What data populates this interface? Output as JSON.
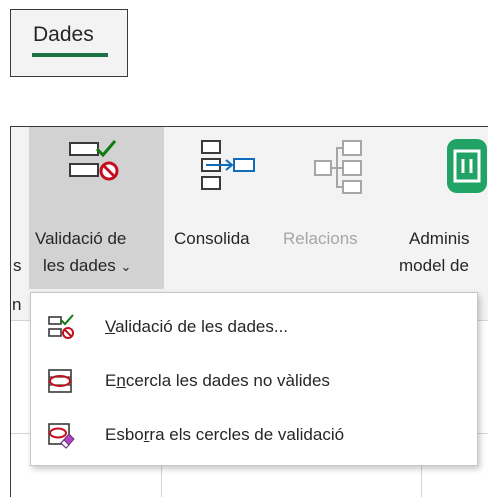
{
  "tab": {
    "label": "Dades"
  },
  "ribbon": {
    "validacio": {
      "line1": "Validació de",
      "line2": "les dades",
      "caret": "⌄"
    },
    "consolida": {
      "label": "Consolida"
    },
    "relacions": {
      "label": "Relacions"
    },
    "admin": {
      "line1": "Adminis",
      "line2": "model de"
    },
    "fragments": {
      "left_line2": "s",
      "group_label": "n"
    }
  },
  "menu": {
    "items": [
      {
        "label": "Validació de les dades...",
        "icon": "data-validation-icon",
        "mnemonic": "V"
      },
      {
        "label": "Encercla les dades no vàlides",
        "icon": "circle-invalid-data-icon",
        "mnemonic": "n"
      },
      {
        "label": "Esborra els cercles de validació",
        "icon": "clear-validation-circles-icon",
        "mnemonic": "r"
      }
    ]
  },
  "colors": {
    "accent": "#1e7145",
    "validation_red": "#c50f1f",
    "validation_green": "#107c10",
    "ribbon_bg": "#f3f3f3",
    "pressed_bg": "#d2d2d2"
  }
}
